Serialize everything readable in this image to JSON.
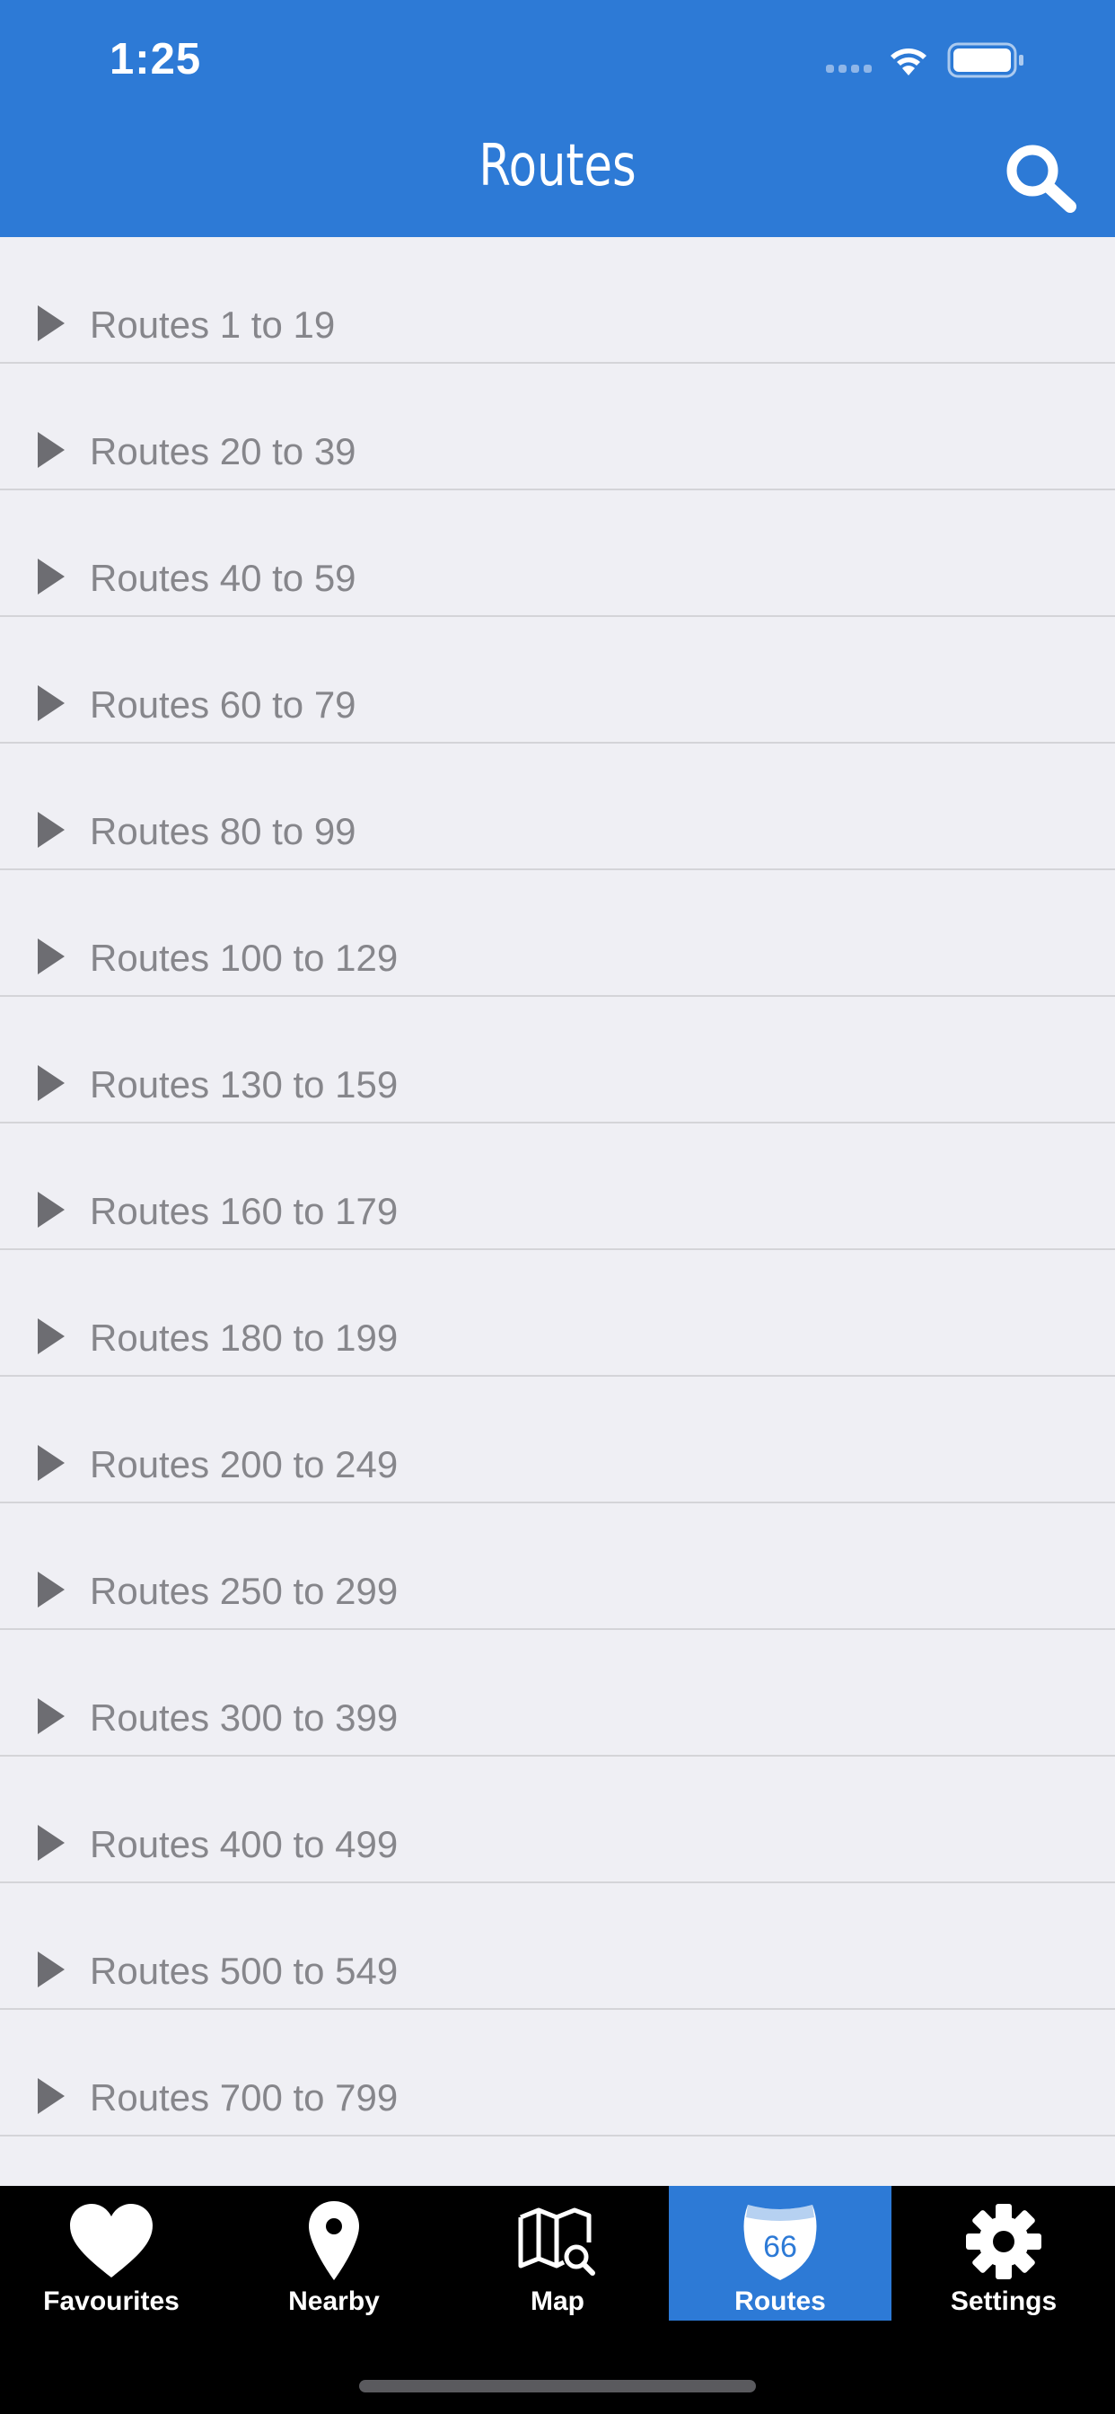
{
  "status_bar": {
    "time": "1:25"
  },
  "nav_bar": {
    "title": "Routes",
    "search_icon": "search-icon"
  },
  "route_groups": [
    {
      "label": "Routes 1 to 19"
    },
    {
      "label": "Routes 20 to 39"
    },
    {
      "label": "Routes 40 to 59"
    },
    {
      "label": "Routes 60 to 79"
    },
    {
      "label": "Routes 80 to 99"
    },
    {
      "label": "Routes 100 to 129"
    },
    {
      "label": "Routes 130 to 159"
    },
    {
      "label": "Routes 160 to 179"
    },
    {
      "label": "Routes 180 to 199"
    },
    {
      "label": "Routes 200 to 249"
    },
    {
      "label": "Routes 250 to 299"
    },
    {
      "label": "Routes 300 to 399"
    },
    {
      "label": "Routes 400 to 499"
    },
    {
      "label": "Routes 500 to 549"
    },
    {
      "label": "Routes 700 to 799"
    }
  ],
  "tab_bar": {
    "tabs": [
      {
        "label": "Favourites",
        "icon": "heart-icon"
      },
      {
        "label": "Nearby",
        "icon": "location-pin-icon"
      },
      {
        "label": "Map",
        "icon": "map-search-icon"
      },
      {
        "label": "Routes",
        "icon": "route-shield-icon",
        "shield_number": "66"
      },
      {
        "label": "Settings",
        "icon": "gear-icon"
      }
    ],
    "active": "Routes"
  },
  "colors": {
    "accent": "#2d7ad6",
    "background": "#efeff4",
    "tab_bar": "#000000",
    "row_text": "#86868b"
  }
}
